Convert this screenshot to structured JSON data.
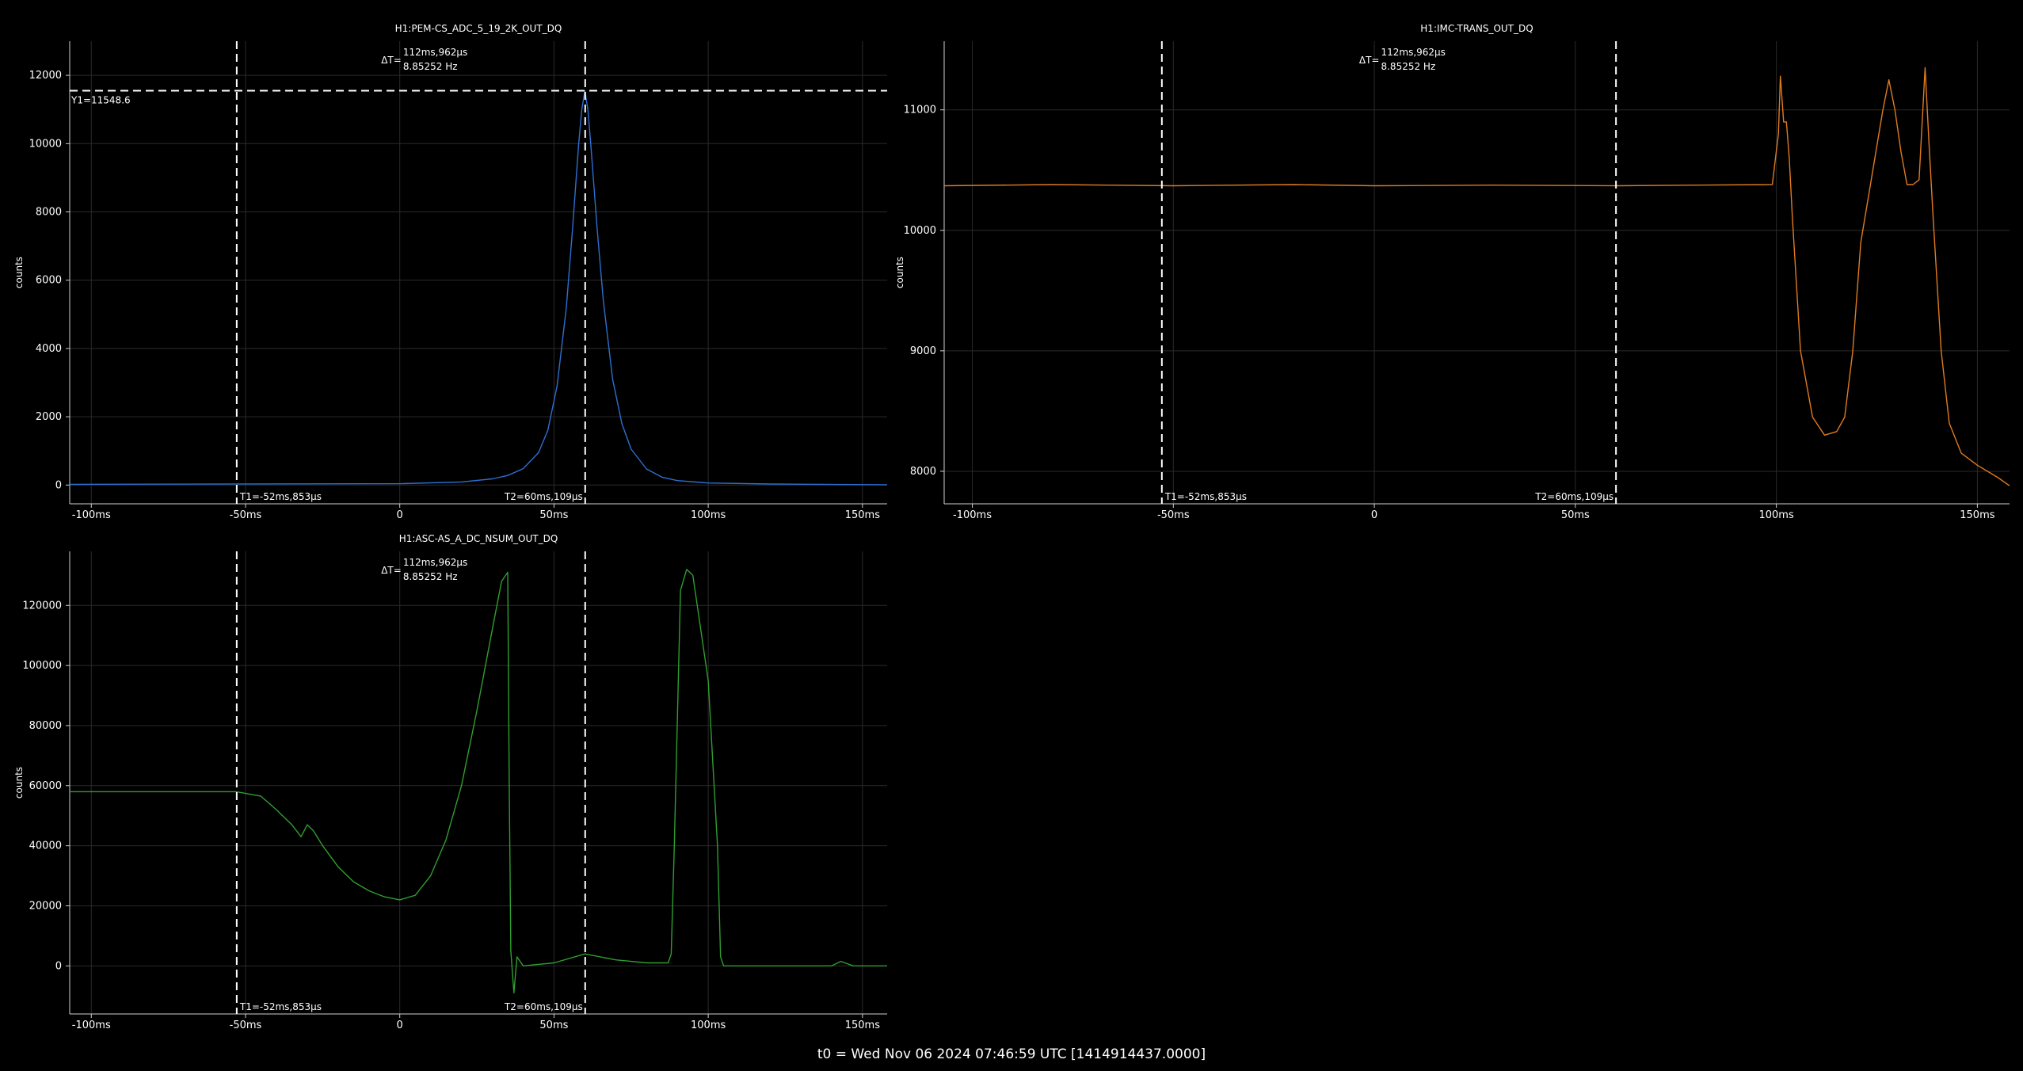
{
  "colors": {
    "background": "#000000",
    "grid": "#2a2a2a",
    "axis": "#d0d0d0",
    "text": "#ffffff",
    "cursor": "#ffffff"
  },
  "x_tick_labels": [
    "-100ms",
    "-50ms",
    "0",
    "50ms",
    "100ms",
    "150ms"
  ],
  "x_ticks_s": [
    -0.1,
    -0.05,
    0,
    0.05,
    0.1,
    0.15
  ],
  "cursors": {
    "t1_label": "T1=-52ms,853μs",
    "t2_label": "T2=60ms,109μs",
    "t1_s": -0.052853,
    "t2_s": 0.060109,
    "delta_prefix": "ΔT=",
    "delta_time": "112ms,962μs",
    "delta_freq": "8.85252 Hz"
  },
  "chart_data": [
    {
      "type": "line",
      "title": "H1:PEM-CS_ADC_5_19_2K_OUT_DQ",
      "ylabel": "counts",
      "color": "#2e6fd0",
      "xlim": [
        -0.107,
        0.158
      ],
      "ylim": [
        -550,
        13000
      ],
      "y_ticks": [
        0,
        2000,
        4000,
        6000,
        8000,
        10000,
        12000
      ],
      "y_tick_labels": [
        "0",
        "2000",
        "4000",
        "6000",
        "8000",
        "10000",
        "12000"
      ],
      "y_cursor": {
        "label": "Y1=11548.6",
        "value": 11548.6
      },
      "x": [
        -0.107,
        0.0,
        0.02,
        0.03,
        0.035,
        0.04,
        0.045,
        0.048,
        0.051,
        0.054,
        0.056,
        0.058,
        0.059,
        0.06,
        0.061,
        0.062,
        0.064,
        0.066,
        0.069,
        0.072,
        0.075,
        0.08,
        0.085,
        0.09,
        0.1,
        0.12,
        0.158
      ],
      "y": [
        20,
        40,
        90,
        180,
        280,
        480,
        950,
        1600,
        2900,
        5200,
        7500,
        10000,
        11000,
        11540,
        11000,
        9900,
        7500,
        5400,
        3100,
        1800,
        1050,
        470,
        230,
        130,
        60,
        30,
        10
      ]
    },
    {
      "type": "line",
      "title": "H1:IMC-TRANS_OUT_DQ",
      "ylabel": "counts",
      "color": "#e07b20",
      "xlim": [
        -0.107,
        0.158
      ],
      "ylim": [
        7730,
        11570
      ],
      "y_ticks": [
        8000,
        9000,
        10000,
        11000
      ],
      "y_tick_labels": [
        "8000",
        "9000",
        "10000",
        "11000"
      ],
      "x": [
        -0.107,
        -0.08,
        -0.05,
        -0.02,
        0.0,
        0.03,
        0.06,
        0.08,
        0.099,
        0.1005,
        0.101,
        0.1018,
        0.1025,
        0.1032,
        0.104,
        0.106,
        0.109,
        0.112,
        0.115,
        0.117,
        0.119,
        0.121,
        0.123,
        0.125,
        0.1265,
        0.128,
        0.1295,
        0.131,
        0.1325,
        0.134,
        0.1355,
        0.137,
        0.138,
        0.139,
        0.141,
        0.143,
        0.146,
        0.15,
        0.155,
        0.158
      ],
      "y": [
        10370,
        10380,
        10370,
        10380,
        10370,
        10375,
        10370,
        10375,
        10380,
        10800,
        11280,
        10900,
        10900,
        10600,
        10100,
        9000,
        8450,
        8300,
        8330,
        8450,
        9000,
        9900,
        10300,
        10700,
        11000,
        11250,
        11000,
        10650,
        10380,
        10380,
        10420,
        11350,
        10700,
        10100,
        9000,
        8400,
        8150,
        8050,
        7950,
        7880
      ]
    },
    {
      "type": "line",
      "title": "H1:ASC-AS_A_DC_NSUM_OUT_DQ",
      "ylabel": "counts",
      "color": "#2f9e2f",
      "xlim": [
        -0.107,
        0.158
      ],
      "ylim": [
        -16000,
        138000
      ],
      "y_ticks": [
        0,
        20000,
        40000,
        60000,
        80000,
        100000,
        120000
      ],
      "y_tick_labels": [
        "0",
        "20000",
        "40000",
        "60000",
        "80000",
        "100000",
        "120000"
      ],
      "x": [
        -0.107,
        -0.053,
        -0.045,
        -0.04,
        -0.035,
        -0.032,
        -0.03,
        -0.028,
        -0.025,
        -0.02,
        -0.015,
        -0.01,
        -0.005,
        0.0,
        0.005,
        0.01,
        0.015,
        0.02,
        0.025,
        0.03,
        0.033,
        0.035,
        0.0355,
        0.036,
        0.037,
        0.038,
        0.04,
        0.05,
        0.06,
        0.07,
        0.08,
        0.087,
        0.088,
        0.089,
        0.091,
        0.093,
        0.095,
        0.1,
        0.103,
        0.104,
        0.105,
        0.12,
        0.13,
        0.14,
        0.143,
        0.147,
        0.158
      ],
      "y": [
        58000,
        58000,
        56500,
        52000,
        47000,
        43000,
        47000,
        45000,
        40000,
        33000,
        28000,
        25000,
        23000,
        22000,
        23500,
        30000,
        42000,
        60000,
        85000,
        112000,
        128000,
        131000,
        60000,
        5000,
        -9000,
        3000,
        0,
        1000,
        4000,
        2000,
        1000,
        1000,
        4000,
        40000,
        125000,
        132000,
        130000,
        95000,
        40000,
        3000,
        0,
        0,
        0,
        0,
        1500,
        0,
        0
      ]
    }
  ],
  "footer": "t0 = Wed Nov 06 2024 07:46:59 UTC [1414914437.0000]"
}
